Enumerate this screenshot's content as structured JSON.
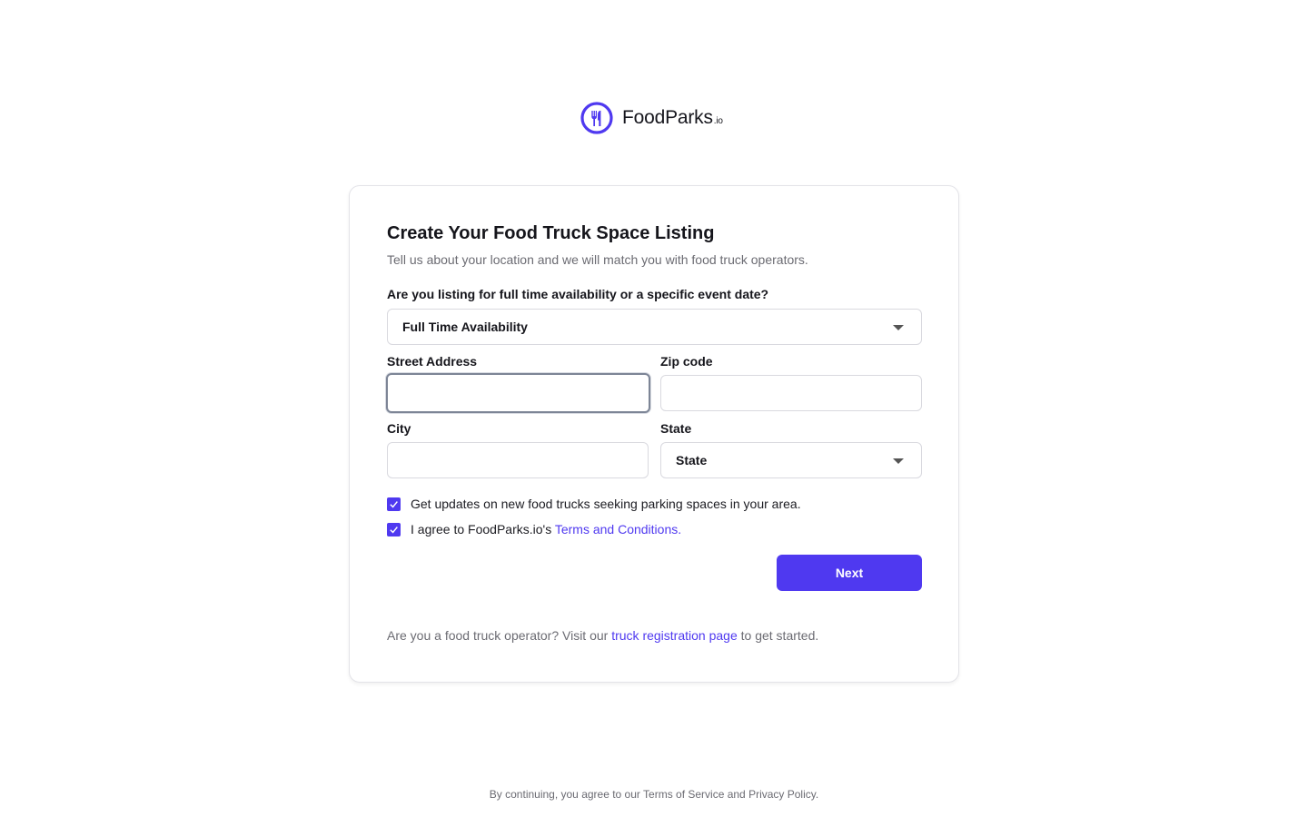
{
  "brand": {
    "name": "FoodParks",
    "suffix": ".io",
    "logo_icon": "fork-knife-circle-icon",
    "accent_color": "#4f39f0"
  },
  "form": {
    "title": "Create Your Food Truck Space Listing",
    "subtitle": "Tell us about your location and we will match you with food truck operators.",
    "availability_question": "Are you listing for full time availability or a specific event date?",
    "availability_selected": "Full Time Availability",
    "street_address_label": "Street Address",
    "street_address_value": "",
    "zip_label": "Zip code",
    "zip_value": "",
    "city_label": "City",
    "city_value": "",
    "state_label": "State",
    "state_selected": "State",
    "updates_checkbox": {
      "checked": true,
      "label": "Get updates on new food trucks seeking parking spaces in your area."
    },
    "terms_checkbox": {
      "checked": true,
      "label_prefix": "I agree to FoodParks.io's ",
      "link_text": "Terms and Conditions",
      "label_suffix": "."
    },
    "next_label": "Next",
    "operator_prefix": "Are you a food truck operator? Visit our ",
    "operator_link": "truck registration page",
    "operator_suffix": " to get started."
  },
  "footer": {
    "text": "By continuing, you agree to our Terms of Service and Privacy Policy."
  }
}
